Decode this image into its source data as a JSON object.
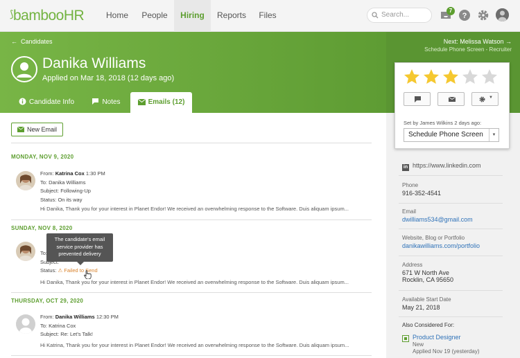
{
  "nav": {
    "logo": "bambooHR",
    "items": [
      "Home",
      "People",
      "Hiring",
      "Reports",
      "Files"
    ],
    "search_placeholder": "Search...",
    "inbox_badge": "7",
    "accent": "#5d9e2f"
  },
  "header": {
    "back": "Candidates",
    "name": "Danika Williams",
    "applied": "Applied on Mar 18, 2018 (12 days ago)",
    "next_label": "Next: Melissa Watson",
    "next_sub": "Schedule Phone Screen - Recruiter"
  },
  "tabs": [
    {
      "label": "Candidate Info"
    },
    {
      "label": "Notes"
    },
    {
      "label": "Emails (12)"
    }
  ],
  "rating": {
    "stars": 3,
    "max": 5,
    "set_by": "Set by James Wilkins 2 days ago:",
    "stage": "Schedule Phone Screen"
  },
  "sidebar": {
    "linkedin": "https://www.linkedin.com",
    "phone_label": "Phone",
    "phone": "916-352-4541",
    "email_label": "Email",
    "email": "dwilliams534@gmail.com",
    "web_label": "Website, Blog or Portfolio",
    "web": "danikawilliams.com/portfolio",
    "address_label": "Address",
    "address1": "671 W North Ave",
    "address2": "Rocklin, CA 95650",
    "start_label": "Available Start Date",
    "start": "May 21, 2018",
    "also_label": "Also Considered For:",
    "job": "Product Designer",
    "job_status": "New",
    "job_applied": "Applied Nov 19 (yesterday)"
  },
  "emails": {
    "new_button": "New Email",
    "groups": [
      {
        "date": "MONDAY, NOV 9, 2020",
        "from_label": "From:",
        "from": "Katrina Cox",
        "time": "1:30 PM",
        "to_label": "To:",
        "to": "Danika Williams",
        "subject_label": "Subject:",
        "subject": "Following-Up",
        "status_label": "Status:",
        "status": "On its way",
        "body": "Hi Danika, Thank you for your interest in Planet Endor! We received an overwhelming response to the Software. Duis aliquam ipsum..."
      },
      {
        "date": "SUNDAY, NOV 8, 2020",
        "to_label": "To:",
        "subject_label": "Subject:",
        "status_label": "Status:",
        "status": "Failed to Send",
        "body": "Hi Danika, Thank you for your interest in Planet Endor! We received an overwhelming response to the Software. Duis aliquam ipsum..."
      },
      {
        "date": "THURSDAY, OCT 29, 2020",
        "from_label": "From:",
        "from": "Danika Williams",
        "time": "12:30 PM",
        "to_label": "To:",
        "to": "Katrina Cox",
        "subject_label": "Subject:",
        "subject": "Re: Let's Talk!",
        "body": "Hi Katrina, Thank you for your interest in Planet Endor! We received an overwhelming response to the Software. Duis aliquam ipsum..."
      }
    ]
  },
  "tooltip": "The candidate's email service provider has prevented delivery"
}
